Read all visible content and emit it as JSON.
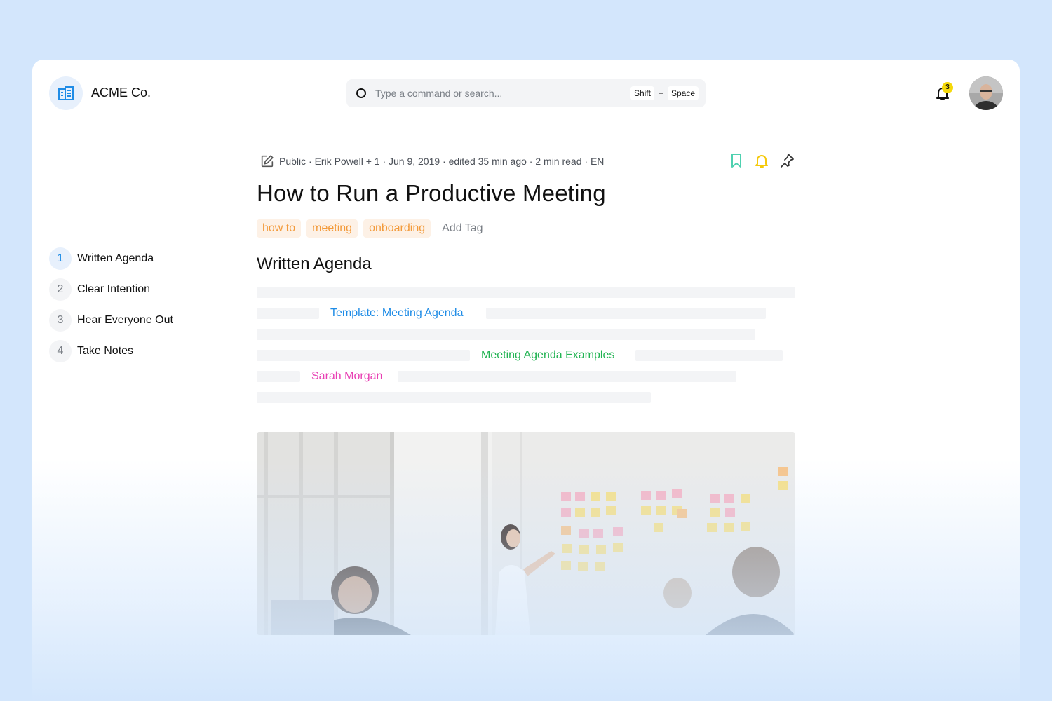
{
  "brand": {
    "name": "ACME Co."
  },
  "search": {
    "placeholder": "Type a command or search...",
    "shortcut_key1": "Shift",
    "shortcut_plus": "+",
    "shortcut_key2": "Space"
  },
  "notifications": {
    "count": "3"
  },
  "toc": {
    "items": [
      {
        "num": "1",
        "label": "Written Agenda"
      },
      {
        "num": "2",
        "label": "Clear Intention"
      },
      {
        "num": "3",
        "label": "Hear Everyone Out"
      },
      {
        "num": "4",
        "label": "Take Notes"
      }
    ]
  },
  "article": {
    "meta": "Public · Erik Powell + 1 · Jun 9, 2019 · edited 35 min ago · 2 min read · EN",
    "title": "How to Run a Productive Meeting",
    "tags": [
      "how to",
      "meeting",
      "onboarding"
    ],
    "add_tag": "Add Tag",
    "section_title": "Written Agenda",
    "links": {
      "template": "Template: Meeting Agenda",
      "examples": "Meeting Agenda Examples",
      "mention": "Sarah Morgan"
    }
  },
  "colors": {
    "background": "#d3e6fc",
    "accent_blue": "#1f8ce6",
    "link_green": "#21b352",
    "mention_pink": "#e83fb3",
    "tag_orange": "#f39a3a",
    "bookmark_teal": "#4fd1b0",
    "bell_yellow": "#f5d90a"
  }
}
